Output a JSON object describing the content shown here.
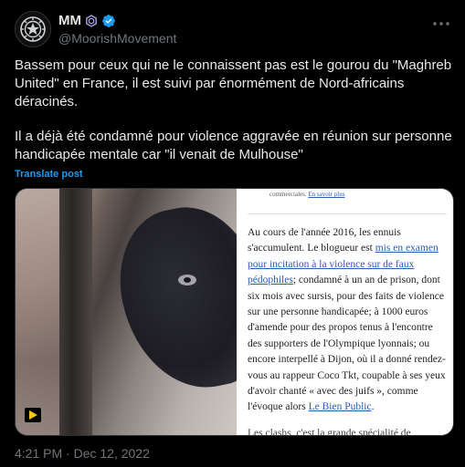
{
  "author": {
    "display_name": "MM",
    "handle": "@MoorishMovement",
    "avatar_icon": "emblem-icon",
    "badges": [
      "hexagon-badge-icon",
      "verified-check-icon"
    ]
  },
  "post": {
    "paragraph1": "Bassem pour ceux qui ne le connaissent pas est le gourou du \"Maghreb United\" en France, il est suivi par énormément de Nord-africains déracinés.",
    "paragraph2": "Il a déjà été condamné pour violence aggravée en réunion sur personne handicapée mentale car \"il venait de Mulhouse\"",
    "translate_label": "Translate post",
    "timestamp": "4:21 PM · Dec 12, 2022"
  },
  "media": {
    "video_badge_icon": "play-icon",
    "article": {
      "top_note": "commerciales.",
      "top_note_link": "En savoir plus",
      "t1": "Au cours de l'année 2016, les ennuis s'accumulent. Le blogueur est ",
      "link1": "mis en examen pour incitation à la violence sur de faux pédophiles",
      "t2": "; condamné à un an de prison, dont six mois avec sursis, pour des faits de violence sur une personne handicapée; à 1000 euros d'amende pour des propos tenus à l'encontre des supporters de l'Olympique lyonnais; ou encore interpellé à Dijon, où il a donné rendez-vous au rappeur Coco Tkt, coupable à ses yeux d'avoir chanté « avec des juifs », comme l'évoque alors ",
      "link2": "Le Bien Public",
      "t3": ".",
      "cut_line": "Les clashs, c'est la grande spécialité de"
    }
  },
  "colors": {
    "background": "#000000",
    "text": "#e7e9ea",
    "muted": "#71767b",
    "accent": "#1d9bf0",
    "badge_purple": "#a8a2e6"
  }
}
